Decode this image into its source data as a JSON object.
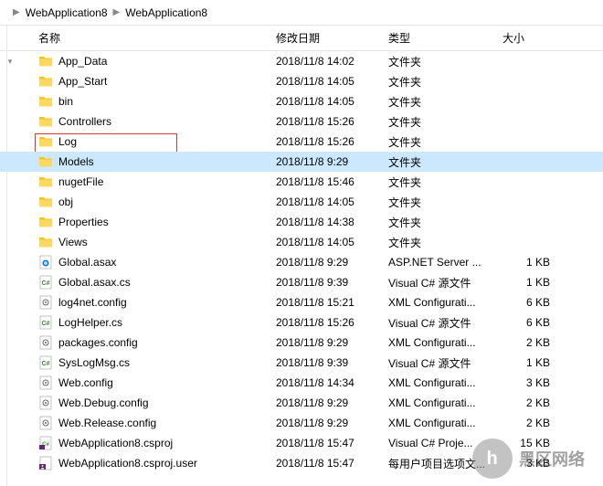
{
  "breadcrumb": {
    "items": [
      "WebApplication8",
      "WebApplication8"
    ]
  },
  "columns": {
    "name": "名称",
    "date": "修改日期",
    "type": "类型",
    "size": "大小"
  },
  "items": [
    {
      "icon": "folder",
      "name": "App_Data",
      "date": "2018/11/8 14:02",
      "type": "文件夹",
      "size": ""
    },
    {
      "icon": "folder",
      "name": "App_Start",
      "date": "2018/11/8 14:05",
      "type": "文件夹",
      "size": ""
    },
    {
      "icon": "folder",
      "name": "bin",
      "date": "2018/11/8 14:05",
      "type": "文件夹",
      "size": ""
    },
    {
      "icon": "folder",
      "name": "Controllers",
      "date": "2018/11/8 15:26",
      "type": "文件夹",
      "size": ""
    },
    {
      "icon": "folder",
      "name": "Log",
      "date": "2018/11/8 15:26",
      "type": "文件夹",
      "size": ""
    },
    {
      "icon": "folder",
      "name": "Models",
      "date": "2018/11/8 9:29",
      "type": "文件夹",
      "size": "",
      "selected": true
    },
    {
      "icon": "folder",
      "name": "nugetFile",
      "date": "2018/11/8 15:46",
      "type": "文件夹",
      "size": ""
    },
    {
      "icon": "folder",
      "name": "obj",
      "date": "2018/11/8 14:05",
      "type": "文件夹",
      "size": ""
    },
    {
      "icon": "folder",
      "name": "Properties",
      "date": "2018/11/8 14:38",
      "type": "文件夹",
      "size": ""
    },
    {
      "icon": "folder",
      "name": "Views",
      "date": "2018/11/8 14:05",
      "type": "文件夹",
      "size": ""
    },
    {
      "icon": "asax",
      "name": "Global.asax",
      "date": "2018/11/8 9:29",
      "type": "ASP.NET Server ...",
      "size": "1 KB"
    },
    {
      "icon": "cs",
      "name": "Global.asax.cs",
      "date": "2018/11/8 9:39",
      "type": "Visual C# 源文件",
      "size": "1 KB"
    },
    {
      "icon": "config",
      "name": "log4net.config",
      "date": "2018/11/8 15:21",
      "type": "XML Configurati...",
      "size": "6 KB"
    },
    {
      "icon": "cs",
      "name": "LogHelper.cs",
      "date": "2018/11/8 15:26",
      "type": "Visual C# 源文件",
      "size": "6 KB"
    },
    {
      "icon": "config",
      "name": "packages.config",
      "date": "2018/11/8 9:29",
      "type": "XML Configurati...",
      "size": "2 KB"
    },
    {
      "icon": "cs",
      "name": "SysLogMsg.cs",
      "date": "2018/11/8 9:39",
      "type": "Visual C# 源文件",
      "size": "1 KB"
    },
    {
      "icon": "config",
      "name": "Web.config",
      "date": "2018/11/8 14:34",
      "type": "XML Configurati...",
      "size": "3 KB"
    },
    {
      "icon": "config",
      "name": "Web.Debug.config",
      "date": "2018/11/8 9:29",
      "type": "XML Configurati...",
      "size": "2 KB"
    },
    {
      "icon": "config",
      "name": "Web.Release.config",
      "date": "2018/11/8 9:29",
      "type": "XML Configurati...",
      "size": "2 KB"
    },
    {
      "icon": "csproj",
      "name": "WebApplication8.csproj",
      "date": "2018/11/8 15:47",
      "type": "Visual C# Proje...",
      "size": "15 KB"
    },
    {
      "icon": "user",
      "name": "WebApplication8.csproj.user",
      "date": "2018/11/8 15:47",
      "type": "每用户项目选项文...",
      "size": "3 KB"
    }
  ],
  "watermark": {
    "symbol": "h",
    "text": "黑区网络",
    "sub": ""
  }
}
